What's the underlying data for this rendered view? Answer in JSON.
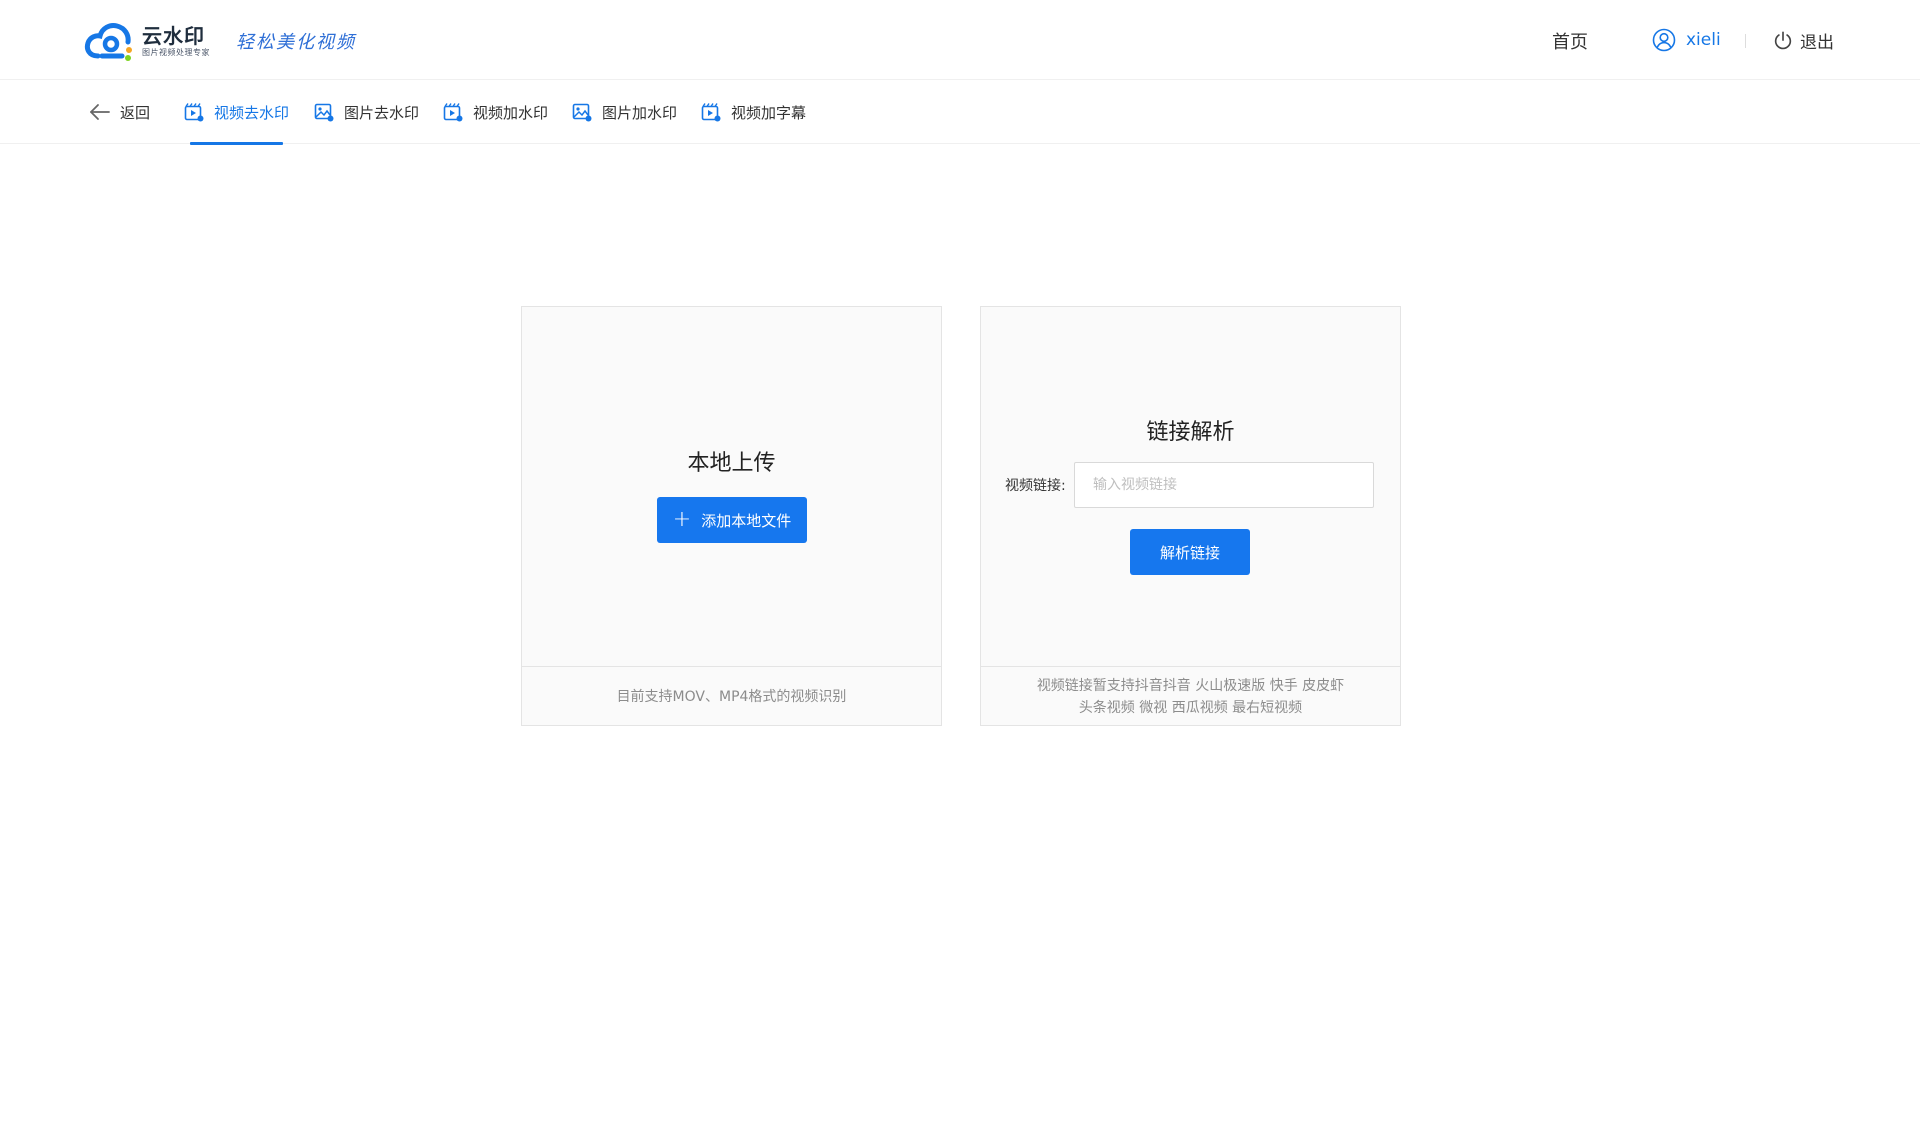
{
  "header": {
    "logo_name": "云水印",
    "logo_sub": "图片视频处理专家",
    "slogan": "轻松美化视频",
    "home_label": "首页",
    "username": "xieli",
    "logout_label": "退出"
  },
  "tabs": {
    "back_label": "返回",
    "items": [
      {
        "label": "视频去水印",
        "icon": "video-icon",
        "active": true
      },
      {
        "label": "图片去水印",
        "icon": "image-icon",
        "active": false
      },
      {
        "label": "视频加水印",
        "icon": "video-icon",
        "active": false
      },
      {
        "label": "图片加水印",
        "icon": "image-icon",
        "active": false
      },
      {
        "label": "视频加字幕",
        "icon": "video-icon",
        "active": false
      }
    ]
  },
  "upload_card": {
    "title": "本地上传",
    "button_label": "添加本地文件",
    "footer": "目前支持MOV、MP4格式的视频识别"
  },
  "link_card": {
    "title": "链接解析",
    "field_label": "视频链接:",
    "input_placeholder": "输入视频链接",
    "input_value": "",
    "button_label": "解析链接",
    "footer_line1": "视频链接暂支持抖音抖音 火山极速版 快手 皮皮虾",
    "footer_line2": "头条视频 微视 西瓜视频 最右短视频"
  },
  "colors": {
    "accent": "#1677ee",
    "text": "#333333",
    "muted": "#8c8c8c"
  }
}
